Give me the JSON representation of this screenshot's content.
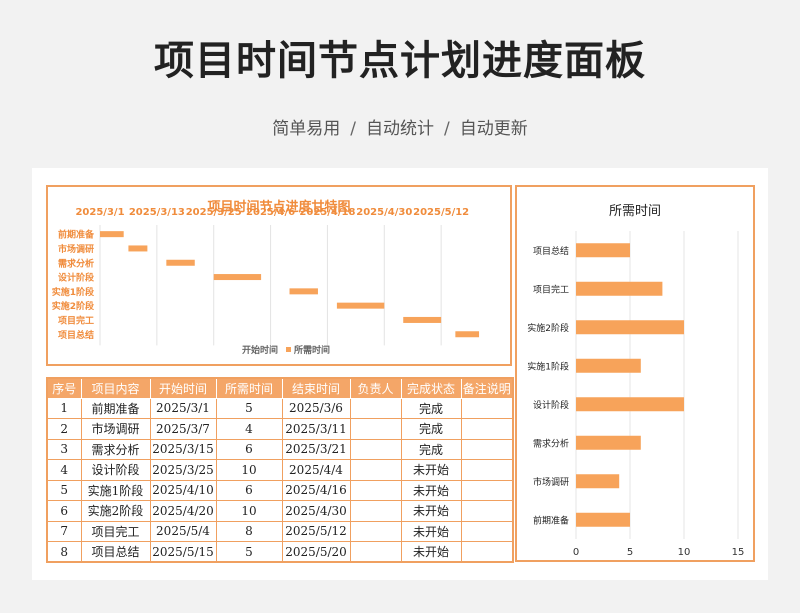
{
  "page": {
    "title": "项目时间节点计划进度面板",
    "subtitle_parts": [
      "简单易用",
      "自动统计",
      "自动更新"
    ],
    "subtitle_sep": "/"
  },
  "colors": {
    "accent": "#f4a668",
    "bar": "#f7a35a",
    "border": "#f0a060",
    "text_orange": "#f08c3c"
  },
  "table": {
    "headers": [
      "序号",
      "项目内容",
      "开始时间",
      "所需时间",
      "结束时间",
      "负责人",
      "完成状态",
      "备注说明"
    ],
    "rows": [
      [
        "1",
        "前期准备",
        "2025/3/1",
        "5",
        "2025/3/6",
        "",
        "完成",
        ""
      ],
      [
        "2",
        "市场调研",
        "2025/3/7",
        "4",
        "2025/3/11",
        "",
        "完成",
        ""
      ],
      [
        "3",
        "需求分析",
        "2025/3/15",
        "6",
        "2025/3/21",
        "",
        "完成",
        ""
      ],
      [
        "4",
        "设计阶段",
        "2025/3/25",
        "10",
        "2025/4/4",
        "",
        "未开始",
        ""
      ],
      [
        "5",
        "实施1阶段",
        "2025/4/10",
        "6",
        "2025/4/16",
        "",
        "未开始",
        ""
      ],
      [
        "6",
        "实施2阶段",
        "2025/4/20",
        "10",
        "2025/4/30",
        "",
        "未开始",
        ""
      ],
      [
        "7",
        "项目完工",
        "2025/5/4",
        "8",
        "2025/5/12",
        "",
        "未开始",
        ""
      ],
      [
        "8",
        "项目总结",
        "2025/5/15",
        "5",
        "2025/5/20",
        "",
        "未开始",
        ""
      ]
    ]
  },
  "chart_data": [
    {
      "type": "bar",
      "orientation": "horizontal",
      "stacked": true,
      "title": "项目时间节点进度甘特图",
      "categories": [
        "前期准备",
        "市场调研",
        "需求分析",
        "设计阶段",
        "实施1阶段",
        "实施2阶段",
        "项目完工",
        "项目总结"
      ],
      "series": [
        {
          "name": "开始时间",
          "values": [
            "2025/3/1",
            "2025/3/7",
            "2025/3/15",
            "2025/3/25",
            "2025/4/10",
            "2025/4/20",
            "2025/5/4",
            "2025/5/15"
          ],
          "hidden": true
        },
        {
          "name": "所需时间",
          "values": [
            5,
            4,
            6,
            10,
            6,
            10,
            8,
            5
          ]
        }
      ],
      "x_tick_labels": [
        "2025/3/1",
        "2025/3/13",
        "2025/3/25",
        "2025/4/6",
        "2025/4/18",
        "2025/4/30",
        "2025/5/12"
      ],
      "xlim": [
        "2025/3/1",
        "2025/5/24"
      ],
      "legend": "bottom",
      "grid": true
    },
    {
      "type": "bar",
      "orientation": "horizontal",
      "title": "所需时间",
      "categories": [
        "项目总结",
        "项目完工",
        "实施2阶段",
        "实施1阶段",
        "设计阶段",
        "需求分析",
        "市场调研",
        "前期准备"
      ],
      "values": [
        5,
        8,
        10,
        6,
        10,
        6,
        4,
        5
      ],
      "x_ticks": [
        0,
        5,
        10,
        15
      ],
      "xlim": [
        0,
        15
      ],
      "grid": true
    }
  ]
}
